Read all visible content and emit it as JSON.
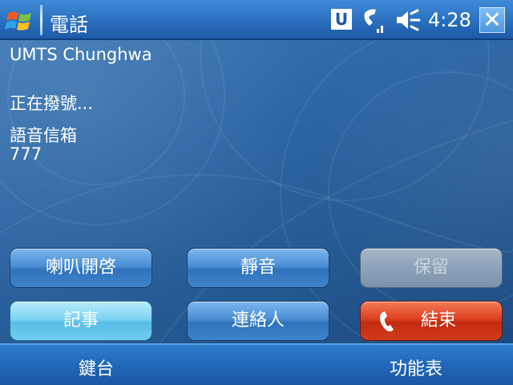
{
  "titlebar": {
    "app_title": "電話",
    "u_badge": "U",
    "clock": "4:28",
    "close_glyph": "✕",
    "icons": [
      "windows-start-icon",
      "phone-signal-icon",
      "volume-icon",
      "close-icon"
    ]
  },
  "call": {
    "carrier": "UMTS Chunghwa",
    "status": "正在撥號...",
    "contact_name": "語音信箱",
    "contact_number": "777"
  },
  "buttons": {
    "speaker": "喇叭開啓",
    "mute": "靜音",
    "hold": "保留",
    "notes": "記事",
    "contacts": "連絡人",
    "end": "結束"
  },
  "softkeys": {
    "left": "鍵台",
    "right": "功能表"
  },
  "colors": {
    "title_bar": "#2a6fbf",
    "background": "#2e67a6",
    "button_blue": "#4b8fd3",
    "button_notes": "#7fd3f3",
    "button_hold_disabled": "#8ca2b8",
    "button_end": "#de3f20"
  }
}
